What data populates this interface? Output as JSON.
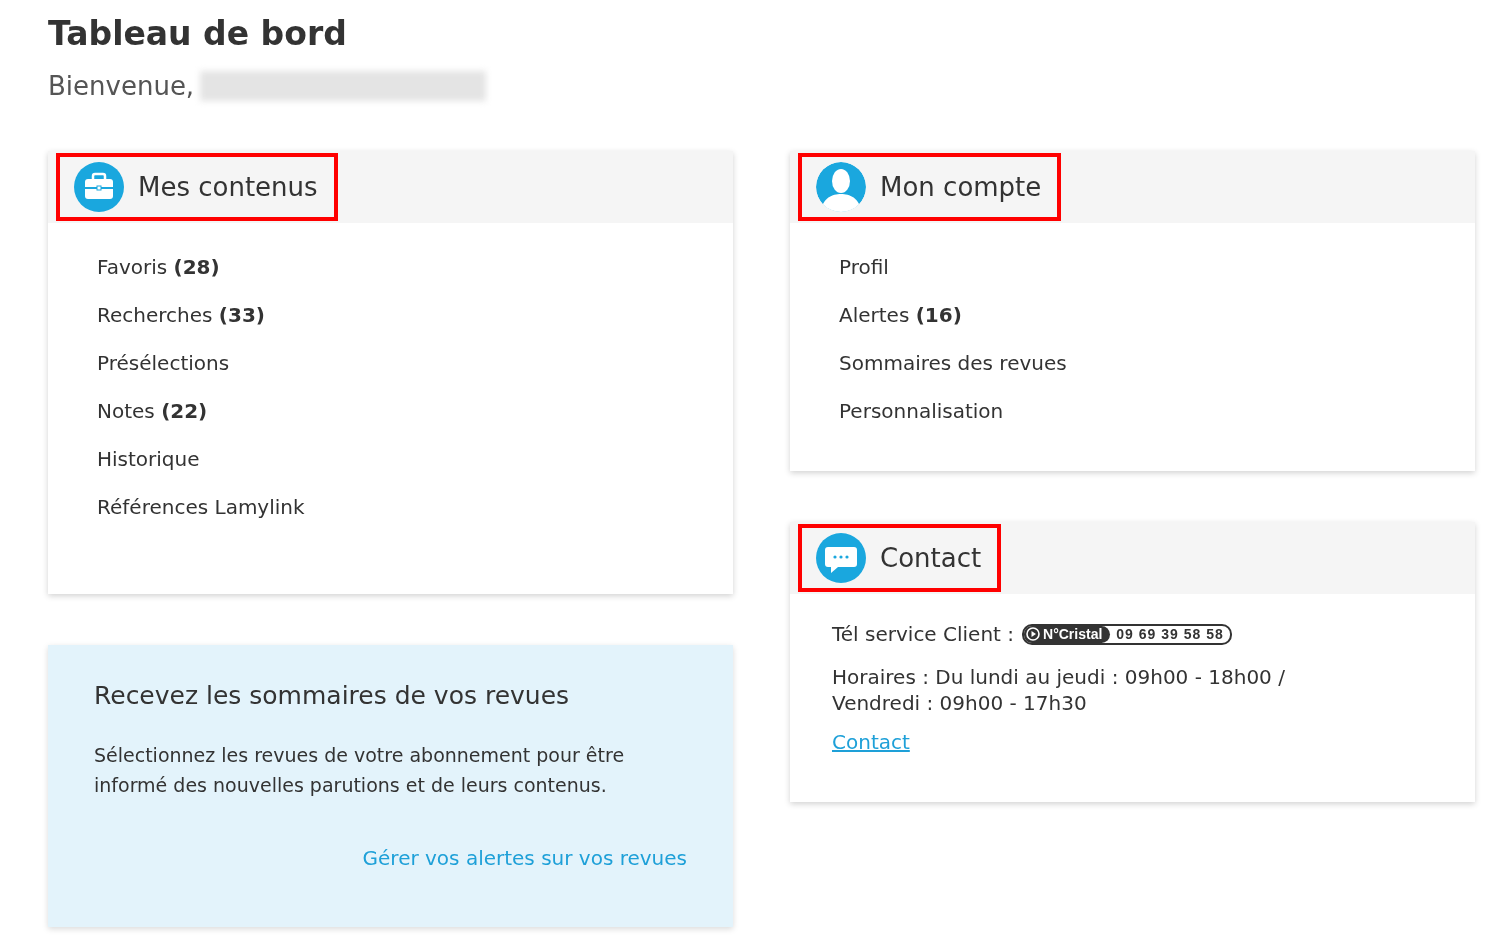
{
  "page": {
    "title": "Tableau de bord",
    "greeting": "Bienvenue,"
  },
  "mes_contenus": {
    "title": "Mes contenus",
    "highlighted": true,
    "items": [
      {
        "label": "Favoris **(28)**"
      },
      {
        "label": "Recherches **(33)**"
      },
      {
        "label": "Présélections"
      },
      {
        "label": "Notes **(22)**"
      },
      {
        "label": "Historique"
      },
      {
        "label": "Références Lamylink"
      }
    ]
  },
  "promo": {
    "title": "Recevez les sommaires de vos revues",
    "text": "Sélectionnez les revues de votre abonnement pour être informé des nouvelles parutions et de leurs contenus.",
    "link": "Gérer vos alertes sur vos revues"
  },
  "mon_compte": {
    "title": "Mon compte",
    "highlighted": true,
    "items": [
      {
        "label": "Profil"
      },
      {
        "label": "Alertes **(16)**"
      },
      {
        "label": "Sommaires des revues"
      },
      {
        "label": "Personnalisation"
      }
    ]
  },
  "contact": {
    "title": "Contact",
    "highlighted": true,
    "phone_label": "Tél service Client :",
    "badge_brand": "N°Cristal",
    "badge_number": "09 69 39 58 58",
    "hours": "Horaires : Du lundi au jeudi : 09h00 - 18h00 / Vendredi : 09h00 - 17h30",
    "link": "Contact"
  }
}
